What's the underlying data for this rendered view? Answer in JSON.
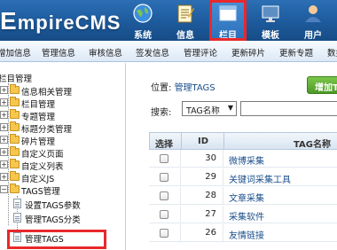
{
  "header": {
    "logo_text": "EmpireCMS",
    "nav": [
      {
        "label": "系统",
        "icon": "globe-icon"
      },
      {
        "label": "信息",
        "icon": "notepad-icon"
      },
      {
        "label": "栏目",
        "icon": "window-icon"
      },
      {
        "label": "模板",
        "icon": "monitor-icon"
      },
      {
        "label": "用户",
        "icon": "user-icon"
      }
    ]
  },
  "subnav": [
    "增加信息",
    "管理信息",
    "审核信息",
    "签发信息",
    "管理评论",
    "更新碎片",
    "更新专题",
    "数据"
  ],
  "sidebar": {
    "root": "栏目管理",
    "items": [
      "信息相关管理",
      "栏目管理",
      "专题管理",
      "标题分类管理",
      "碎片管理",
      "自定义页面",
      "自定义列表",
      "自定义JS",
      "TAGS管理"
    ],
    "tags_children": [
      "设置TAGS参数",
      "管理TAGS分类",
      "管理TAGS"
    ]
  },
  "main": {
    "position_label": "位置:",
    "position_link": "管理TAGS",
    "add_button": "增加TAG",
    "search_label": "搜索:",
    "search_select": "TAG名称",
    "search_input": "",
    "columns": {
      "select": "选择",
      "id": "ID",
      "name": "TAG名称"
    },
    "rows": [
      {
        "id": "30",
        "name": "微博采集"
      },
      {
        "id": "29",
        "name": "关键词采集工具"
      },
      {
        "id": "28",
        "name": "文章采集"
      },
      {
        "id": "27",
        "name": "采集软件"
      },
      {
        "id": "26",
        "name": "友情链接"
      }
    ]
  },
  "colors": {
    "header_blue": "#1d5a9c",
    "highlight_red": "#e8282b",
    "add_green": "#5aaa2e"
  }
}
